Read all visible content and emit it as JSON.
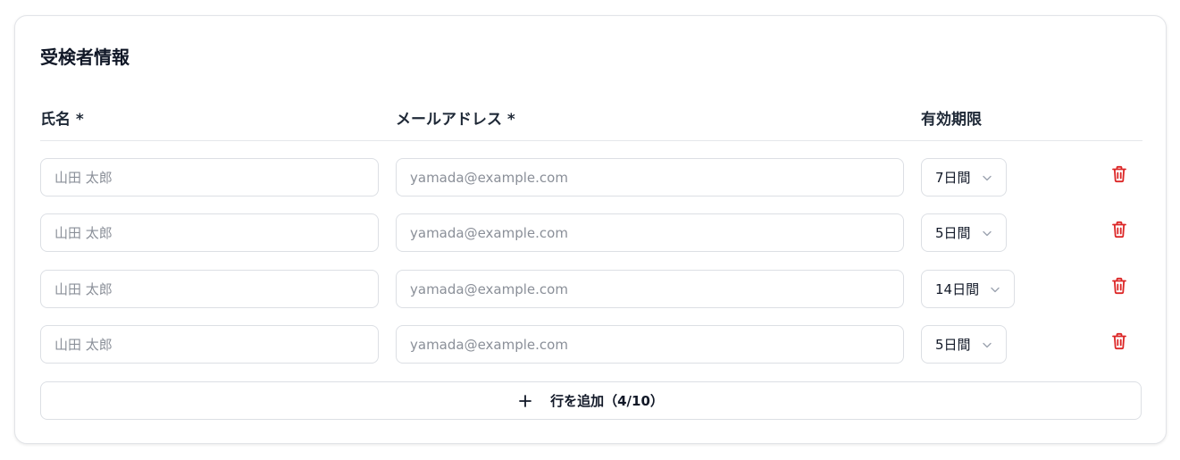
{
  "section": {
    "title": "受検者情報"
  },
  "columns": {
    "name": "氏名 *",
    "email": "メールアドレス *",
    "expiry": "有効期限"
  },
  "rows": [
    {
      "name_placeholder": "山田 太郎",
      "email_placeholder": "yamada@example.com",
      "expiry": "7日間"
    },
    {
      "name_placeholder": "山田 太郎",
      "email_placeholder": "yamada@example.com",
      "expiry": "5日間"
    },
    {
      "name_placeholder": "山田 太郎",
      "email_placeholder": "yamada@example.com",
      "expiry": "14日間"
    },
    {
      "name_placeholder": "山田 太郎",
      "email_placeholder": "yamada@example.com",
      "expiry": "5日間"
    }
  ],
  "add_row": {
    "label": "行を追加（4/10）",
    "icon": "plus-icon"
  },
  "icons": {
    "delete": "trash-icon",
    "select": "chevron-down-icon"
  },
  "colors": {
    "delete": "#dc2626",
    "border": "#dcdfe4",
    "placeholder": "#8a8f98"
  }
}
